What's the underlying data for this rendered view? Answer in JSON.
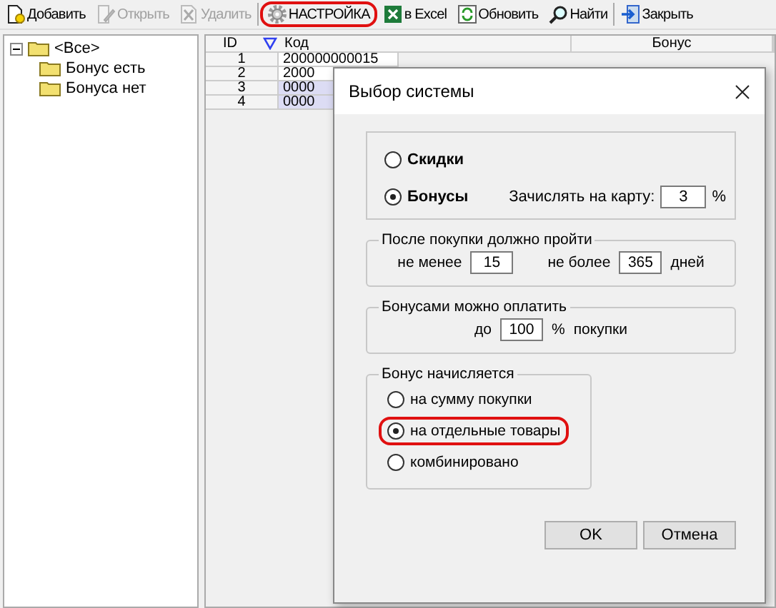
{
  "toolbar": [
    {
      "label": "Добавить",
      "kind": "add",
      "disabled": false,
      "highlighted": false
    },
    {
      "label": "Открыть",
      "kind": "edit",
      "disabled": true,
      "highlighted": false
    },
    {
      "label": "Удалить",
      "kind": "delete",
      "disabled": true,
      "highlighted": false
    },
    {
      "label": "НАСТРОЙКА",
      "kind": "gear",
      "disabled": false,
      "highlighted": true
    },
    {
      "label": "в Excel",
      "kind": "excel",
      "disabled": false,
      "highlighted": false
    },
    {
      "label": "Обновить",
      "kind": "refresh",
      "disabled": false,
      "highlighted": false
    },
    {
      "label": "Найти",
      "kind": "find",
      "disabled": false,
      "highlighted": false
    },
    {
      "label": "Закрыть",
      "kind": "exit",
      "disabled": false,
      "highlighted": false
    }
  ],
  "tree": [
    {
      "label": "<Все>",
      "expanded": true,
      "children": [
        {
          "label": "Бонус есть"
        },
        {
          "label": "Бонуса нет"
        }
      ]
    }
  ],
  "table": {
    "columns": [
      "ID",
      "Код",
      "Бонус"
    ],
    "rows": [
      {
        "cells": [
          "1",
          "200000000015"
        ],
        "selected": false
      },
      {
        "cells": [
          "2",
          "2000"
        ],
        "selected": false
      },
      {
        "cells": [
          "3",
          "0000"
        ],
        "selected": true
      },
      {
        "cells": [
          "4",
          "0000"
        ],
        "selected": true
      }
    ]
  },
  "dialog": {
    "title": "Выбор системы",
    "system": [
      {
        "label": "Скидки",
        "selected": false
      },
      {
        "label": "Бонусы",
        "selected": true
      }
    ],
    "credit_label": "Зачислять на карту:",
    "credit_value": "3",
    "credit_unit": "%",
    "period": {
      "title": "После покупки должно пройти",
      "min_label": "не менее",
      "min_value": "15",
      "max_label": "не более",
      "max_value": "365",
      "unit": "дней"
    },
    "pay": {
      "title": "Бонусами можно оплатить",
      "prefix": "до",
      "value": "100",
      "unit": "%",
      "suffix": "покупки"
    },
    "accrual": {
      "title": "Бонус начисляется",
      "options": [
        {
          "label": "на сумму покупки",
          "selected": false,
          "highlighted": false
        },
        {
          "label": "на отдельные товары",
          "selected": true,
          "highlighted": true
        },
        {
          "label": "комбинировано",
          "selected": false,
          "highlighted": false
        }
      ]
    },
    "buttons": [
      "OK",
      "Отмена"
    ]
  }
}
